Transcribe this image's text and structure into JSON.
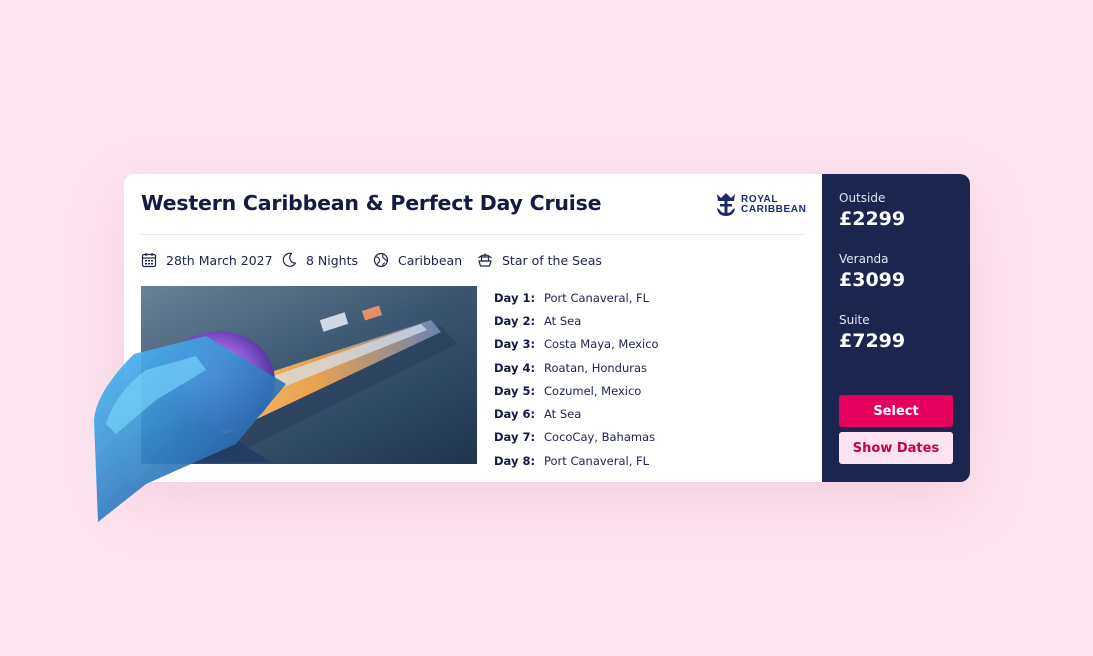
{
  "cruise": {
    "title": "Western Caribbean & Perfect Day Cruise",
    "brand": {
      "line1": "ROYAL",
      "line2": "CARIBBEAN",
      "icon": "crown-anchor-logo-icon"
    },
    "meta": [
      {
        "icon": "calendar-icon",
        "text": "28th March 2027"
      },
      {
        "icon": "moon-icon",
        "text": "8 Nights"
      },
      {
        "icon": "globe-icon",
        "text": "Caribbean"
      },
      {
        "icon": "ship-icon",
        "text": "Star of the Seas"
      }
    ],
    "itinerary": [
      {
        "day": "Day 1:",
        "place": "Port Canaveral, FL"
      },
      {
        "day": "Day 2:",
        "place": "At Sea"
      },
      {
        "day": "Day 3:",
        "place": "Costa Maya, Mexico"
      },
      {
        "day": "Day 4:",
        "place": "Roatan, Honduras"
      },
      {
        "day": "Day 5:",
        "place": "Cozumel, Mexico"
      },
      {
        "day": "Day 6:",
        "place": "At Sea"
      },
      {
        "day": "Day 7:",
        "place": "CocoCay, Bahamas"
      },
      {
        "day": "Day 8:",
        "place": "Port Canaveral, FL"
      }
    ]
  },
  "pricing": [
    {
      "label": "Outside",
      "price": "£2299"
    },
    {
      "label": "Veranda",
      "price": "£3099"
    },
    {
      "label": "Suite",
      "price": "£7299"
    }
  ],
  "actions": {
    "select_label": "Select",
    "show_dates_label": "Show Dates"
  },
  "colors": {
    "background": "#fde3ef",
    "navy": "#1b2550",
    "accent": "#e8005f",
    "brand": "#1a2a6c"
  }
}
